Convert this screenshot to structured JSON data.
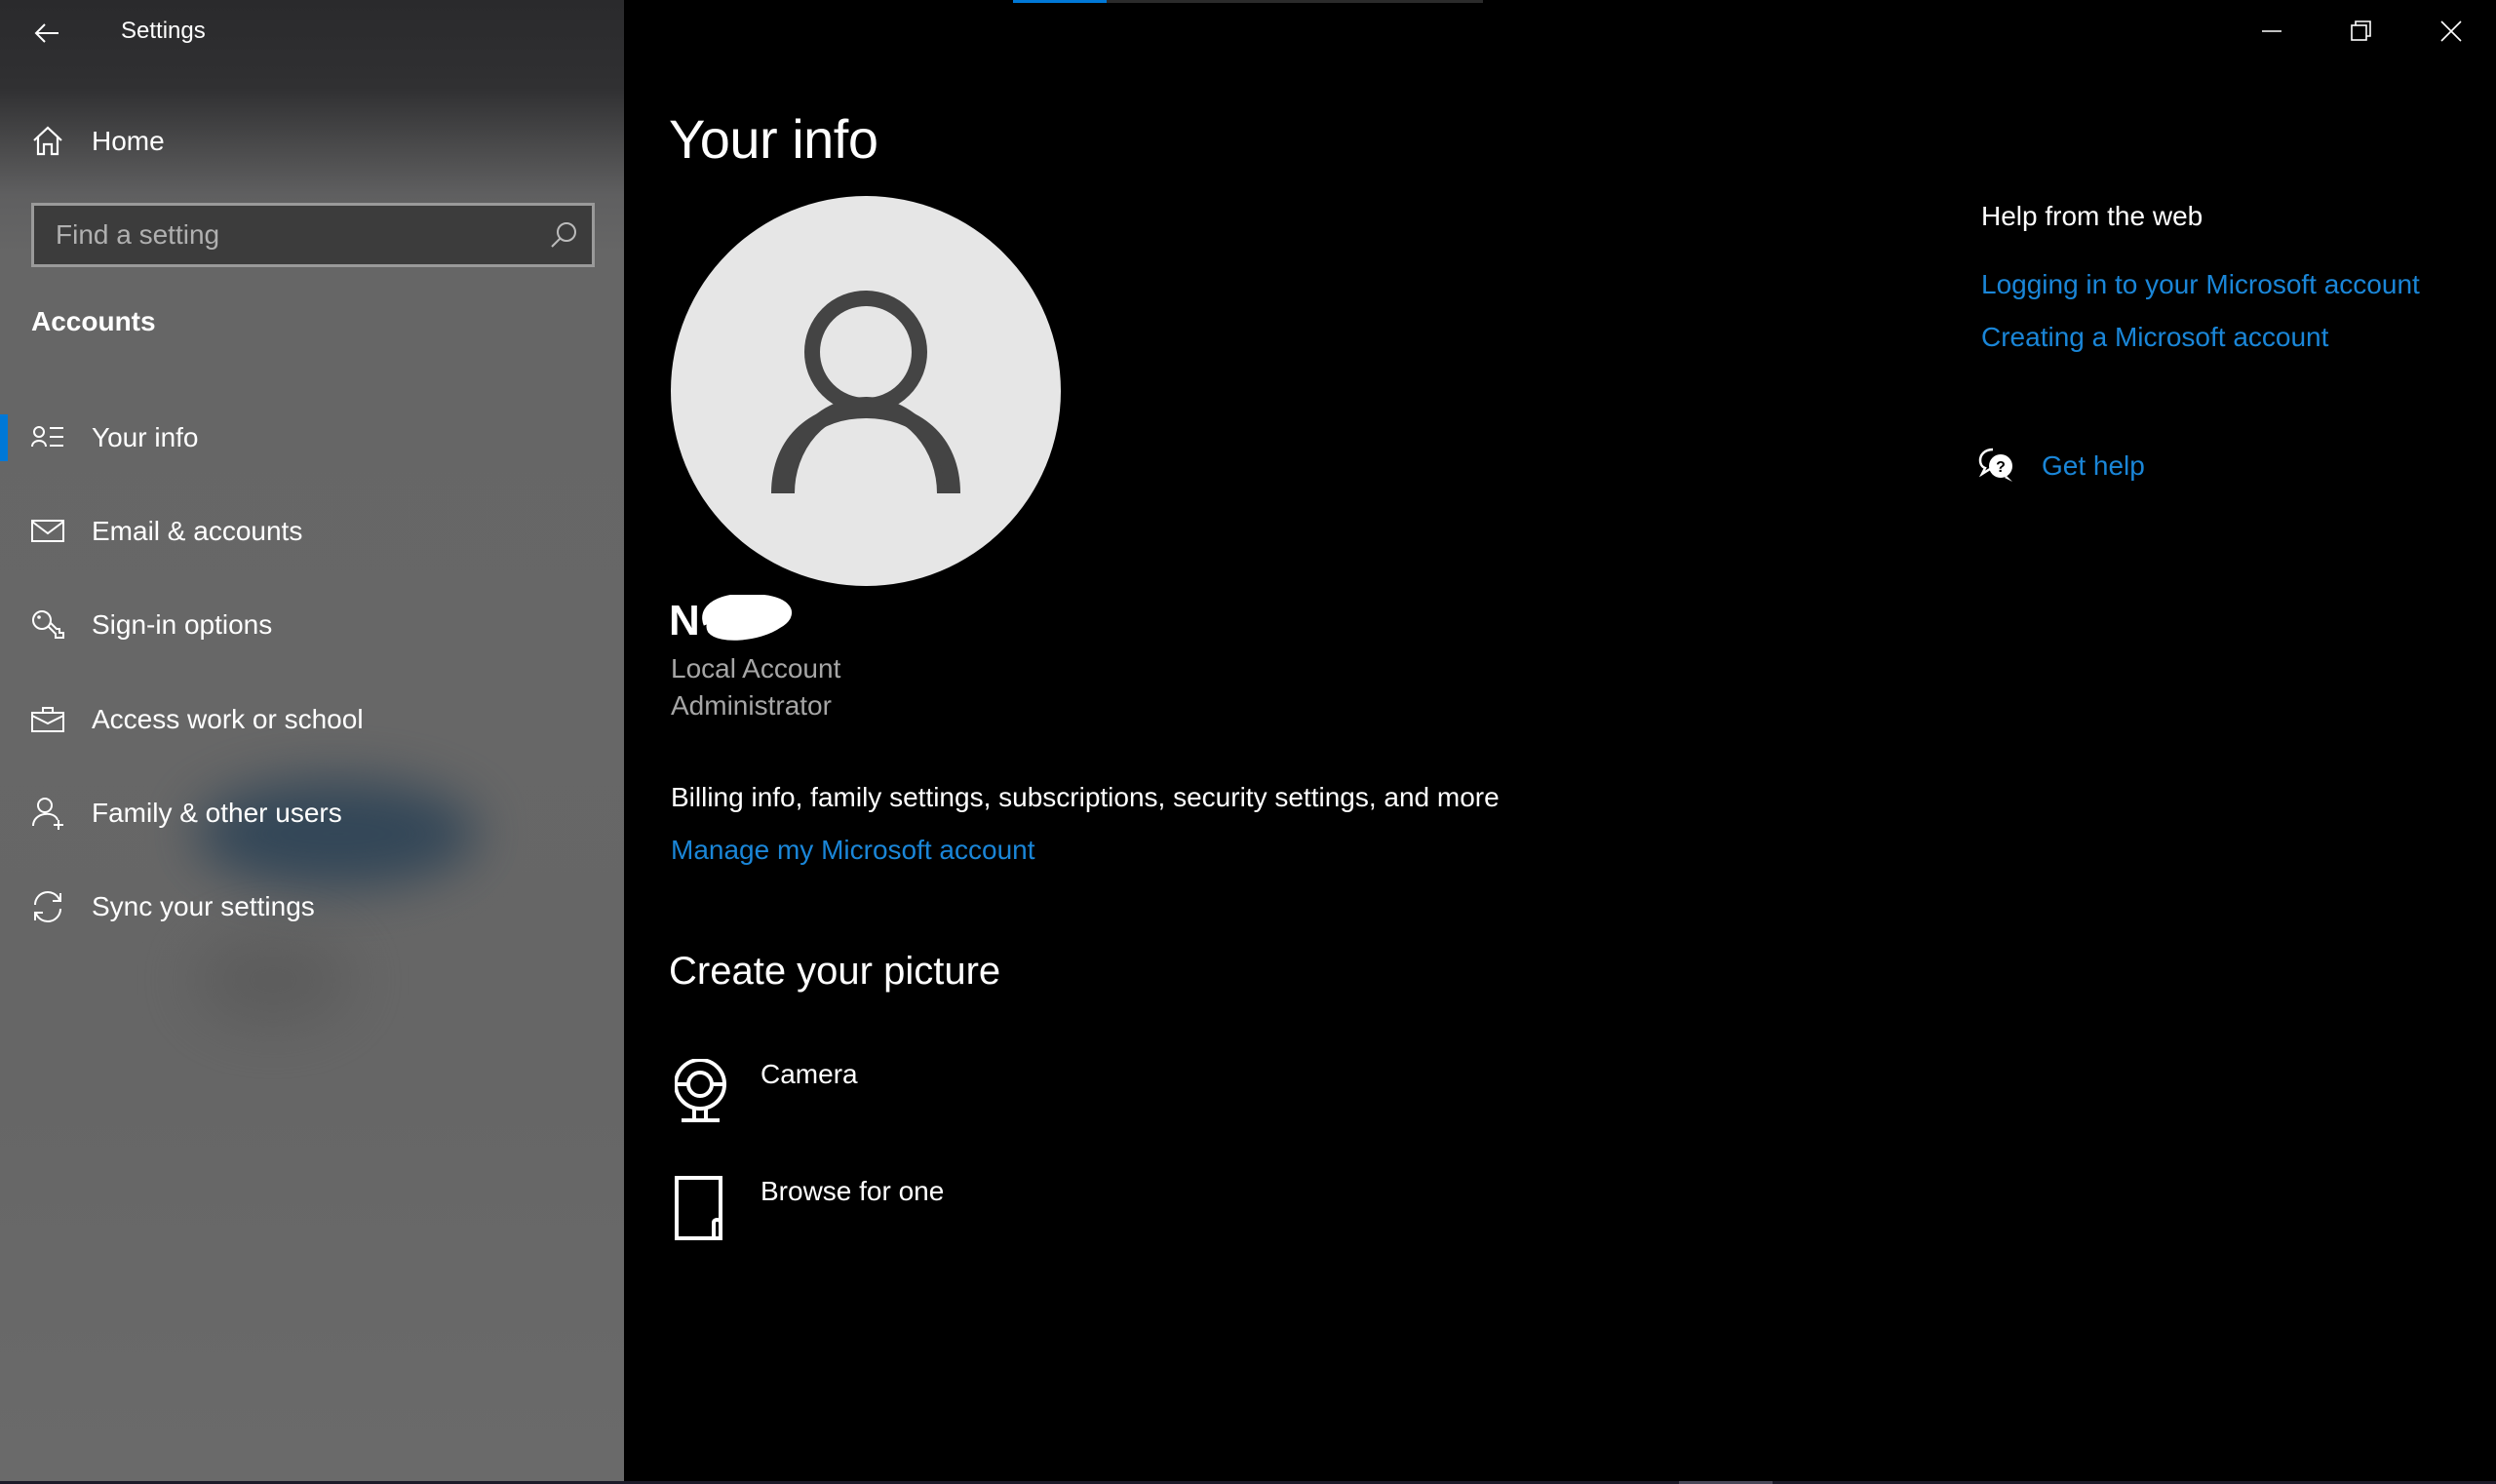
{
  "window": {
    "app_title": "Settings",
    "controls": {
      "minimize_icon": "minimize-icon",
      "restore_icon": "restore-icon",
      "close_icon": "close-icon"
    },
    "loading_progress": 0.2,
    "accent_color": "#0078D7",
    "link_color": "#1A86D8"
  },
  "sidebar": {
    "back_icon": "back-arrow-icon",
    "home": {
      "label": "Home",
      "icon": "home-icon"
    },
    "search": {
      "placeholder": "Find a setting",
      "value": "",
      "icon": "search-icon"
    },
    "section_title": "Accounts",
    "items": [
      {
        "label": "Your info",
        "icon": "your-info-icon",
        "selected": true
      },
      {
        "label": "Email & accounts",
        "icon": "mail-icon",
        "selected": false
      },
      {
        "label": "Sign-in options",
        "icon": "key-icon",
        "selected": false
      },
      {
        "label": "Access work or school",
        "icon": "briefcase-icon",
        "selected": false
      },
      {
        "label": "Family & other users",
        "icon": "add-user-icon",
        "selected": false
      },
      {
        "label": "Sync your settings",
        "icon": "sync-icon",
        "selected": false
      }
    ]
  },
  "main": {
    "title": "Your info",
    "avatar_icon": "default-user-avatar-icon",
    "user_name": "N",
    "user_name_redacted": true,
    "account_type": "Local Account",
    "account_role": "Administrator",
    "billing_text": "Billing info, family settings, subscriptions, security settings, and more",
    "manage_link": "Manage my Microsoft account",
    "create_picture": {
      "title": "Create your picture",
      "options": [
        {
          "label": "Camera",
          "icon": "camera-icon"
        },
        {
          "label": "Browse for one",
          "icon": "browse-file-icon"
        }
      ]
    }
  },
  "help_panel": {
    "title": "Help from the web",
    "links": [
      "Logging in to your Microsoft account",
      "Creating a Microsoft account"
    ],
    "get_help": {
      "label": "Get help",
      "icon": "get-help-chat-icon"
    }
  }
}
